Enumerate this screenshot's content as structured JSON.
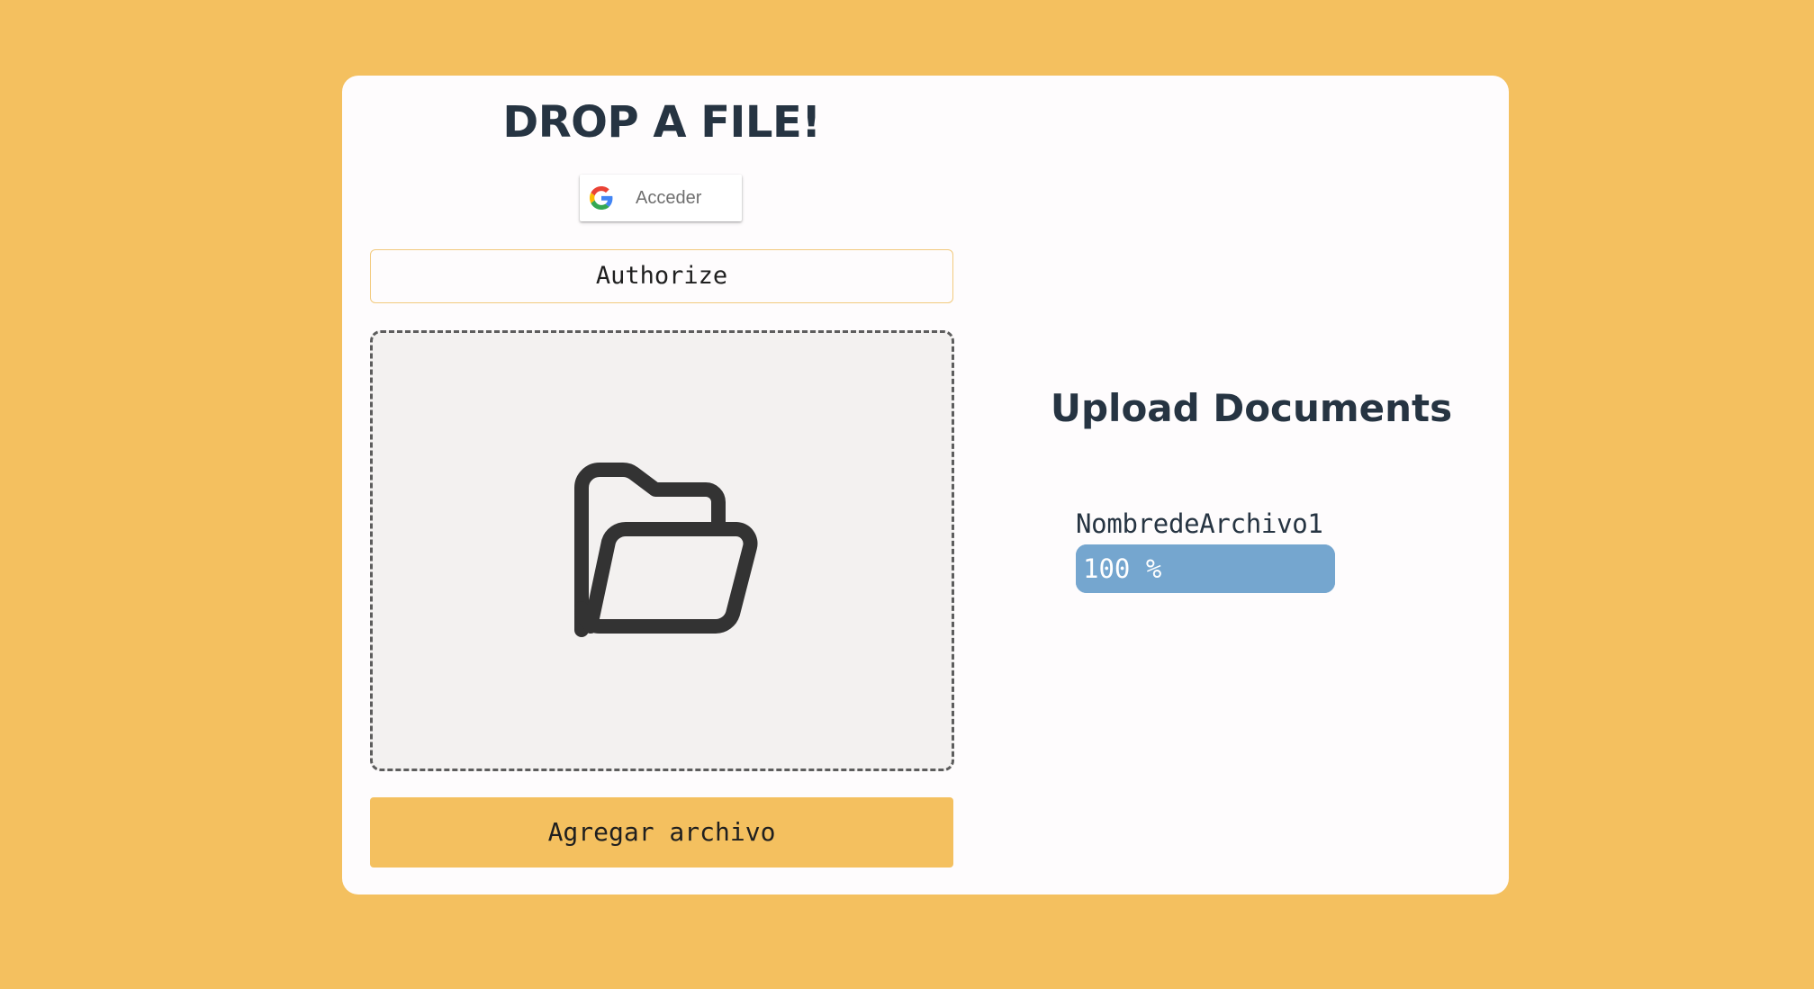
{
  "header": {
    "title": "DROP A FILE!"
  },
  "google_signin": {
    "label": "Acceder"
  },
  "authorize": {
    "label": "Authorize"
  },
  "dropzone": {
    "icon": "folder-open-icon"
  },
  "add_file": {
    "label": "Agregar archivo"
  },
  "upload_panel": {
    "title": "Upload Documents",
    "files": [
      {
        "name": "NombredeArchivo1",
        "progress_label": "100 %",
        "progress": 1.0
      }
    ]
  },
  "colors": {
    "background": "#f4c05f",
    "card": "#fefcfd",
    "heading": "#263442",
    "progress": "#75a6cf",
    "dropzone": "#f3f1f0"
  }
}
